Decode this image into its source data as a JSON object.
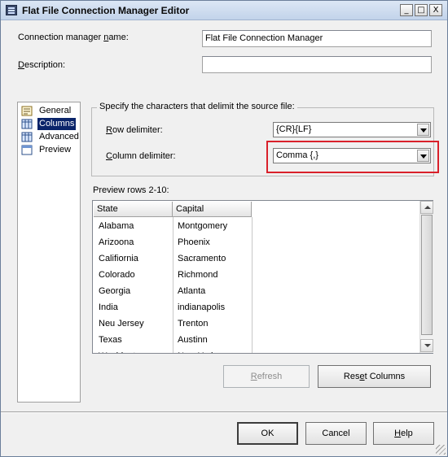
{
  "window": {
    "title": "Flat File Connection Manager Editor",
    "controls": {
      "minimize": "_",
      "maximize": "□",
      "close": "X"
    }
  },
  "form": {
    "name_label_pre": "Connection manager ",
    "name_label_u": "n",
    "name_label_post": "ame:",
    "name_value": "Flat File Connection Manager",
    "desc_label_u": "D",
    "desc_label_post": "escription:",
    "desc_value": ""
  },
  "nav": {
    "items": [
      {
        "label": "General",
        "icon": "general-page-icon",
        "selected": false
      },
      {
        "label": "Columns",
        "icon": "columns-page-icon",
        "selected": true
      },
      {
        "label": "Advanced",
        "icon": "advanced-page-icon",
        "selected": false
      },
      {
        "label": "Preview",
        "icon": "preview-page-icon",
        "selected": false
      }
    ]
  },
  "delimiters": {
    "group_title": "Specify the characters that delimit the source file:",
    "row_label_u": "R",
    "row_label_post": "ow delimiter:",
    "row_value": "{CR}{LF}",
    "col_label_u": "C",
    "col_label_post": "olumn delimiter:",
    "col_value": "Comma {,}",
    "highlight_color": "#d9202a"
  },
  "preview": {
    "label": "Preview rows 2-10:",
    "columns": [
      "State",
      "Capital"
    ],
    "rows": [
      [
        "Alabama",
        "Montgomery"
      ],
      [
        "Arizoona",
        "Phoenix"
      ],
      [
        "Califiornia",
        "Sacramento"
      ],
      [
        "Colorado",
        "Richmond"
      ],
      [
        "Georgia",
        "Atlanta"
      ],
      [
        "India",
        "indianapolis"
      ],
      [
        "Neu Jersey",
        "Trenton"
      ],
      [
        "Texas",
        "Austinn"
      ],
      [
        "Washingt...",
        "New York"
      ]
    ]
  },
  "buttons": {
    "refresh_u": "R",
    "refresh_post": "efresh",
    "reset_pre": "Res",
    "reset_u": "e",
    "reset_post": "t Columns",
    "ok": "OK",
    "cancel": "Cancel",
    "help_u": "H",
    "help_post": "elp"
  }
}
